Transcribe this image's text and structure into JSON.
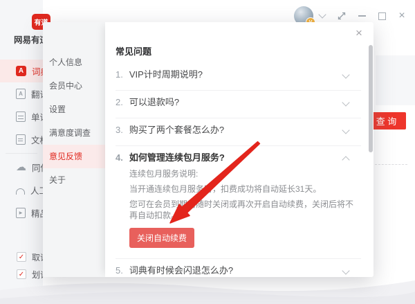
{
  "window": {
    "logo_text": "有道",
    "app_name": "网易有道词典",
    "avatar_badge": "V",
    "close_glyph": "×"
  },
  "sidebar": {
    "items": [
      {
        "id": "dictionary",
        "label": "词典",
        "icon": "dictionary-icon",
        "glyph": "A",
        "active": true
      },
      {
        "id": "translate",
        "label": "翻译",
        "icon": "translate-icon",
        "glyph": "A",
        "active": false
      },
      {
        "id": "wordbook",
        "label": "单词",
        "icon": "wordbook-icon",
        "glyph": "",
        "active": false
      },
      {
        "id": "document",
        "label": "文档",
        "icon": "document-icon",
        "glyph": "",
        "active": false
      },
      {
        "id": "sync",
        "label": "同传",
        "icon": "sync-cloud-icon",
        "glyph": "☁",
        "active": false
      },
      {
        "id": "human",
        "label": "人工",
        "icon": "human-translate-icon",
        "glyph": "",
        "active": false
      },
      {
        "id": "premium",
        "label": "精品",
        "icon": "premium-video-icon",
        "glyph": "▶",
        "active": false
      }
    ],
    "divider_after_index": 3,
    "checkboxes": [
      {
        "id": "capture-word",
        "label": "取词",
        "checked": true,
        "check_glyph": "✓"
      },
      {
        "id": "select-word",
        "label": "划词",
        "checked": true,
        "check_glyph": "✓"
      }
    ]
  },
  "main_background": {
    "query_button": "查 询"
  },
  "dialog": {
    "close_glyph": "×",
    "menu": [
      {
        "id": "profile",
        "label": "个人信息",
        "active": false
      },
      {
        "id": "member-center",
        "label": "会员中心",
        "active": false
      },
      {
        "id": "settings",
        "label": "设置",
        "active": false
      },
      {
        "id": "satisfaction-survey",
        "label": "满意度调查",
        "active": false
      },
      {
        "id": "feedback",
        "label": "意见反馈",
        "active": true
      },
      {
        "id": "about",
        "label": "关于",
        "active": false
      }
    ],
    "faq": {
      "title": "常见问题",
      "items": [
        {
          "num": "1.",
          "question": "VIP计时周期说明?",
          "chevron": "down"
        },
        {
          "num": "2.",
          "question": "可以退款吗?",
          "chevron": "down"
        },
        {
          "num": "3.",
          "question": "购买了两个套餐怎么办?",
          "chevron": "down"
        },
        {
          "num": "4.",
          "question": "如何管理连续包月服务?",
          "chevron": "up",
          "answer_lines": [
            "连续包月服务说明:",
            "当开通连续包月服务时，扣费成功将自动延长31天。",
            "您可在会员到期前随时关闭或再次开启自动续费，关闭后将不再自动扣款。"
          ],
          "button_label": "关闭自动续费"
        },
        {
          "num": "5.",
          "question": "词典有时候会闪退怎么办?",
          "chevron": "down"
        }
      ]
    }
  },
  "colors": {
    "brand_red": "#e0281e",
    "renew_button_red": "#e8605c",
    "query_button_red": "#ee352b",
    "menu_active_bg": "#fbeaea",
    "arrow_red": "#e3251c"
  }
}
